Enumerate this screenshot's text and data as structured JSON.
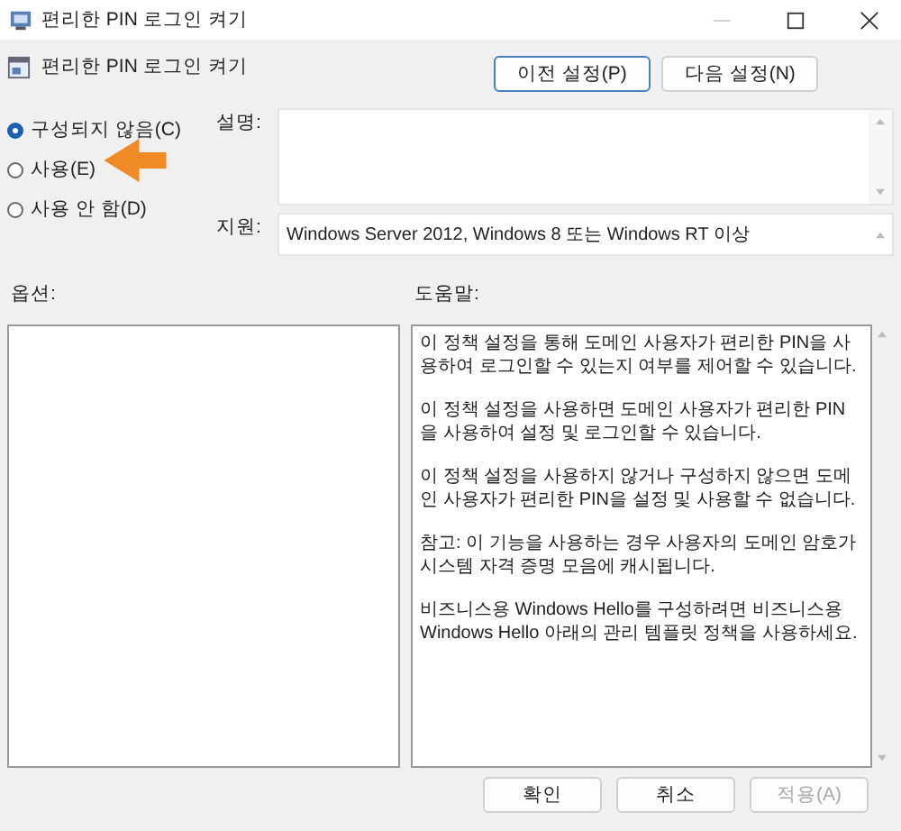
{
  "window": {
    "title": "편리한 PIN 로그인 켜기"
  },
  "heading": "편리한 PIN 로그인 켜기",
  "nav_buttons": [
    {
      "label": "이전 설정(P)",
      "focused": true
    },
    {
      "label": "다음 설정(N)",
      "focused": false
    }
  ],
  "options": [
    {
      "label": "구성되지 않음(C)",
      "selected": true
    },
    {
      "label": "사용(E)",
      "selected": false
    },
    {
      "label": "사용 안 함(D)",
      "selected": false
    }
  ],
  "description": {
    "label": "설명:"
  },
  "support": {
    "label": "지원:",
    "value": "Windows Server 2012, Windows 8 또는 Windows RT 이상"
  },
  "options_label": "옵션:",
  "help_label": "도움말:",
  "help_paragraphs": [
    "이 정책 설정을 통해 도메인 사용자가 편리한 PIN을 사용하여 로그인할 수 있는지 여부를 제어할 수 있습니다.",
    "이 정책 설정을 사용하면 도메인 사용자가 편리한 PIN을 사용하여 설정 및 로그인할 수 있습니다.",
    "이 정책 설정을 사용하지 않거나 구성하지 않으면 도메인 사용자가 편리한 PIN을 설정 및 사용할 수 없습니다.",
    "참고: 이 기능을 사용하는 경우 사용자의 도메인 암호가 시스템 자격 증명 모음에 캐시됩니다.",
    "비즈니스용 Windows Hello를 구성하려면 비즈니스용 Windows Hello 아래의 관리 템플릿 정책을 사용하세요."
  ],
  "footer_buttons": [
    {
      "label": "확인",
      "disabled": false
    },
    {
      "label": "취소",
      "disabled": false
    },
    {
      "label": "적용(A)",
      "disabled": true
    }
  ]
}
